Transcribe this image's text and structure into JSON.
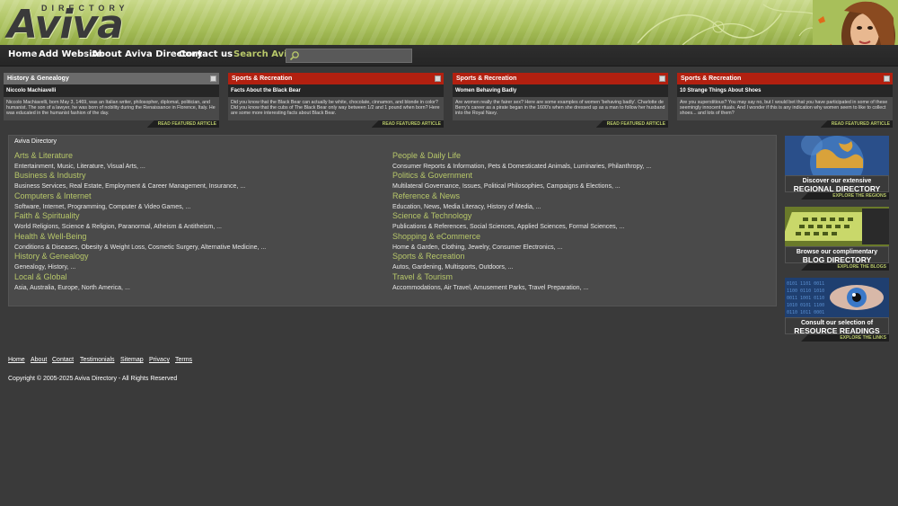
{
  "logo": {
    "small": "DIRECTORY",
    "big": "Aviva"
  },
  "nav": {
    "items": [
      "Home",
      "Add Website",
      "About Aviva Directory",
      "Contact us"
    ],
    "search_label": "Search Aviva:",
    "search_value": ""
  },
  "panels": [
    {
      "category": "History & Genealogy",
      "title": "Niccolo Machiavelli",
      "body": "Niccolo Machiavelli, born May 3, 1469, was an Italian writer, philosopher, diplomat, politician, and humanist. The son of a lawyer, he was born of nobility during the Renaissance in Florence, Italy. He was educated in the humanist fashion of the day.",
      "link": "READ FEATURED ARTICLE",
      "header_color": "#6b6b6b"
    },
    {
      "category": "Sports & Recreation",
      "title": "Facts About the Black Bear",
      "body": "Did you know that the Black Bear can actually be white, chocolate, cinnamon, and blonde in color? Did you know that the cubs of The Black Bear only way between 1/2 and 1 pound when born? Here are some more interesting facts about Black Bear.",
      "link": "READ FEATURED ARTICLE",
      "header_color": "#b22010"
    },
    {
      "category": "Sports & Recreation",
      "title": "Women Behaving Badly",
      "body": "Are women really the fairer sex? Here are some examples of women 'behaving badly'. Charlotte de Berry's career as a pirate began in the 1600's when she dressed up as a man to follow her husband into the Royal Navy.",
      "link": "READ FEATURED ARTICLE",
      "header_color": "#b22010"
    },
    {
      "category": "Sports & Recreation",
      "title": "10 Strange Things About Shoes",
      "body": "Are you superstitious? You may say no, but I would bet that you have participated in some of these seemingly innocent rituals. And I wonder if this is any indication why women seem to like to collect shoes... and lots of them?",
      "link": "READ FEATURED ARTICLE",
      "header_color": "#b22010"
    }
  ],
  "directory": {
    "title": "Aviva Directory",
    "left": [
      {
        "title": "Arts & Literature",
        "sub": "Entertainment, Music, Literature, Visual Arts, ..."
      },
      {
        "title": "Business & Industry",
        "sub": "Business Services, Real Estate, Employment & Career Management, Insurance, ..."
      },
      {
        "title": "Computers & Internet",
        "sub": "Software, Internet, Programming, Computer & Video Games, ..."
      },
      {
        "title": "Faith & Spirituality",
        "sub": "World Religions, Science & Religion, Paranormal, Atheism & Antitheism, ..."
      },
      {
        "title": "Health & Well-Being",
        "sub": "Conditions & Diseases, Obesity & Weight Loss, Cosmetic Surgery, Alternative Medicine, ..."
      },
      {
        "title": "History & Genealogy",
        "sub": "Genealogy, History, ..."
      },
      {
        "title": "Local & Global",
        "sub": "Asia, Australia, Europe, North America, ..."
      }
    ],
    "right": [
      {
        "title": "People & Daily Life",
        "sub": "Consumer Reports & Information, Pets & Domesticated Animals, Luminaries, Philanthropy, ..."
      },
      {
        "title": "Politics & Government",
        "sub": "Multilateral Governance, Issues, Political Philosophies, Campaigns & Elections, ..."
      },
      {
        "title": "Reference & News",
        "sub": "Education, News, Media Literacy, History of Media, ..."
      },
      {
        "title": "Science & Technology",
        "sub": "Publications & References, Social Sciences, Applied Sciences, Formal Sciences, ..."
      },
      {
        "title": "Shopping & eCommerce",
        "sub": "Home & Garden, Clothing, Jewelry, Consumer Electronics, ..."
      },
      {
        "title": "Sports & Recreation",
        "sub": "Autos, Gardening, Multisports, Outdoors, ..."
      },
      {
        "title": "Travel & Tourism",
        "sub": "Accommodations, Air Travel, Amusement Parks, Travel Preparation, ..."
      }
    ]
  },
  "ads": [
    {
      "line1": "Discover our extensive",
      "line2": "REGIONAL DIRECTORY",
      "link": "EXPLORE THE REGIONS"
    },
    {
      "line1": "Browse our complimentary",
      "line2": "BLOG DIRECTORY",
      "link": "EXPLORE THE BLOGS"
    },
    {
      "line1": "Consult our selection of",
      "line2": "RESOURCE READINGS",
      "link": "EXPLORE THE LINKS"
    }
  ],
  "footer": {
    "links": [
      "Home",
      "About",
      "Contact",
      "Testimonials",
      "Sitemap",
      "Privacy",
      "Terms"
    ],
    "copyright": "Copyright © 2005-2025 Aviva Directory - All Rights Reserved"
  },
  "colors": {
    "accent_green": "#b8c86a",
    "header_red": "#b22010",
    "background": "#3a3a3a"
  }
}
